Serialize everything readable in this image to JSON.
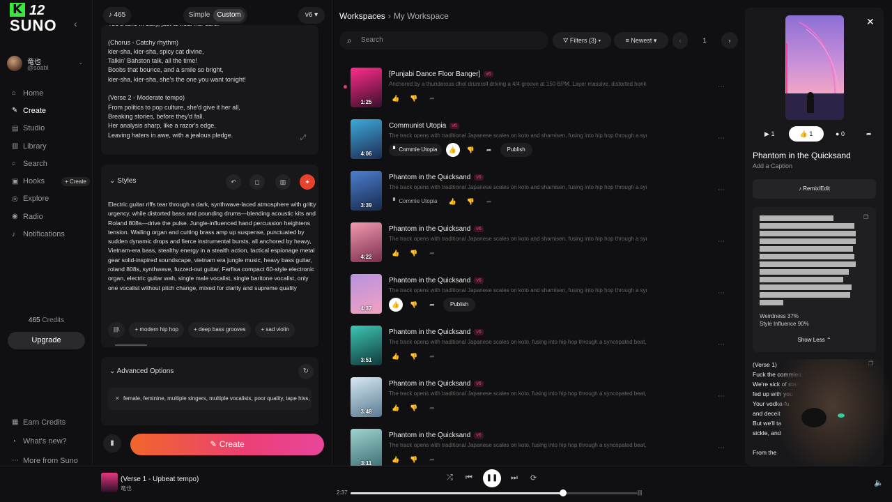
{
  "brand": {
    "logo_mark": "K",
    "logo_num": "12",
    "logo_text": "SUNO"
  },
  "user": {
    "name": "竜也",
    "handle": "@soabl"
  },
  "nav": [
    {
      "label": "Home",
      "icon": "home-icon"
    },
    {
      "label": "Create",
      "icon": "create-icon",
      "active": true
    },
    {
      "label": "Studio",
      "icon": "studio-icon"
    },
    {
      "label": "Library",
      "icon": "library-icon"
    },
    {
      "label": "Search",
      "icon": "search-icon"
    },
    {
      "label": "Hooks",
      "icon": "hooks-icon",
      "pill": "+ Create"
    },
    {
      "label": "Explore",
      "icon": "explore-icon"
    },
    {
      "label": "Radio",
      "icon": "radio-icon"
    },
    {
      "label": "Notifications",
      "icon": "bell-icon"
    }
  ],
  "credits": {
    "value": "465",
    "label": "Credits"
  },
  "upgrade_label": "Upgrade",
  "bottom_nav": [
    {
      "label": "Earn Credits",
      "icon": "gift-icon"
    },
    {
      "label": "What's new?",
      "icon": "bell-icon"
    },
    {
      "label": "More from Suno",
      "icon": "more-icon"
    }
  ],
  "watermark": "72",
  "create": {
    "credits_pill": "465",
    "mode_simple": "Simple",
    "mode_custom": "Custom",
    "version": "v6",
    "lyrics": "You'd tune in daily, just to hear her care.\n\n(Chorus - Catchy rhythm)\nkier-sha, kier-sha, spicy cat divine,\nTalkin' Bahston talk, all the time!\nBoobs that bounce, and a smile so bright,\nkier-sha, kier-sha, she's the one you want tonight!\n\n(Verse 2 - Moderate tempo)\nFrom politics to pop culture, she'd give it her all,\nBreaking stories, before they'd fall.\nHer analysis sharp, like a razor's edge,\nLeaving haters in awe, with a jealous pledge.",
    "styles_label": "Styles",
    "styles_text": "Electric guitar riffs tear through a dark, synthwave-laced atmosphere with gritty urgency, while distorted bass and pounding drums—blending acoustic kits and Roland 808s—drive the pulse. Jungle-influenced hand percussion heightens tension. Wailing organ and cutting brass amp up suspense, punctuated by sudden dynamic drops and fierce instrumental bursts, all anchored by heavy, Vietnam-era bass, stealthy energy in a stealth action, tactical espionage metal gear solid-inspired soundscape, vietnam era jungle music, heavy bass guitar, roland 808s, synthwave, fuzzed-out guitar, Farfisa compact 60-style electronic organ, electric guitar wah, single male vocalist, single baritone vocalist, only one vocalist without pitch change, mixed for clarity and supreme quality",
    "chips": [
      "modern hip hop",
      "deep bass grooves",
      "sad violin"
    ],
    "advanced_label": "Advanced Options",
    "exclude_text": "female, feminine, multiple singers, multiple vocalists, poor quality, tape hiss, vin",
    "create_label": "Create"
  },
  "workspace": {
    "crumb_root": "Workspaces",
    "crumb_current": "My Workspace",
    "search_placeholder": "Search",
    "filters_label": "Filters (3)",
    "sort_label": "Newest",
    "page": "1"
  },
  "songs": [
    {
      "title": "[Punjabi Dance Floor Banger]",
      "badge": "v6",
      "duration": "1:25",
      "desc": "Anchored by a thunderous dhol drumroll driving a 4/4 groove at 150 BPM. Layer massive, distorted honks ...",
      "live": true,
      "colors": [
        "#ff2d8a",
        "#3a0f2c"
      ],
      "actions": "basic"
    },
    {
      "title": "Communist Utopia",
      "badge": "v6",
      "duration": "4:06",
      "desc": "The track opens with traditional Japanese scales on koto and shamisen, fusing into hip hop through a syn...",
      "tag": "Commie Utopia",
      "tag_strong": true,
      "publish": "Publish",
      "colors": [
        "#3fa9d8",
        "#1c2d55"
      ],
      "actions": "liked"
    },
    {
      "title": "Phantom in the Quicksand",
      "badge": "v6",
      "duration": "3:39",
      "desc": "The track opens with traditional Japanese scales on koto and shamisen, fusing into hip hop through a syn...",
      "tag": "Commie Utopia",
      "tag_strong": false,
      "colors": [
        "#4d7fcf",
        "#162a4d"
      ],
      "actions": "basic"
    },
    {
      "title": "Phantom in the Quicksand",
      "badge": "v6",
      "duration": "4:22",
      "desc": "The track opens with traditional Japanese scales on koto and shamisen, fusing into hip hop through a syn...",
      "colors": [
        "#f29ab1",
        "#7a2f4d"
      ],
      "actions": "basic"
    },
    {
      "title": "Phantom in the Quicksand",
      "badge": "v6",
      "duration": "4:37",
      "desc": "The track opens with traditional Japanese scales on koto and shamisen, fusing into hip hop through a syn...",
      "publish": "Publish",
      "colors": [
        "#b693e0",
        "#f4a0c0"
      ],
      "actions": "liked"
    },
    {
      "title": "Phantom in the Quicksand",
      "badge": "v6",
      "duration": "3:51",
      "desc": "The track opens with traditional Japanese scales on koto, fusing into hip hop through a syncopated beat, ...",
      "colors": [
        "#3ec6b4",
        "#0f3a3a"
      ],
      "actions": "basic"
    },
    {
      "title": "Phantom in the Quicksand",
      "badge": "v6",
      "duration": "3:48",
      "desc": "The track opens with traditional Japanese scales on koto, fusing into hip hop through a syncopated beat, ...",
      "colors": [
        "#d8e8f2",
        "#5a7d94"
      ],
      "actions": "basic"
    },
    {
      "title": "Phantom in the Quicksand",
      "badge": "v6",
      "duration": "3:11",
      "desc": "The track opens with traditional Japanese scales on koto, fusing into hip hop through a syncopated beat, ...",
      "colors": [
        "#9fd3d0",
        "#3d6d73"
      ],
      "actions": "basic"
    }
  ],
  "detail": {
    "plays": "1",
    "likes": "1",
    "comments": "0",
    "title": "Phantom in the Quicksand",
    "caption": "Add a Caption",
    "remix_label": "Remix/Edit",
    "weirdness": "Weirdness 37%",
    "style_influence": "Style Influence 90%",
    "show_less": "Show Less",
    "lyrics": "(Verse 1)\nFuck the commies, fuck their red flag too\nWe're sick of starving in the snow, we're\nfed up with you\nYour vodka-fu\nand deceit\nBut we'll ta\nsickle, and\n\nFrom the"
  },
  "player": {
    "title": "(Verse 1 - Upbeat tempo)",
    "artist": "竜也",
    "time": "2:37",
    "progress": 0.74
  }
}
